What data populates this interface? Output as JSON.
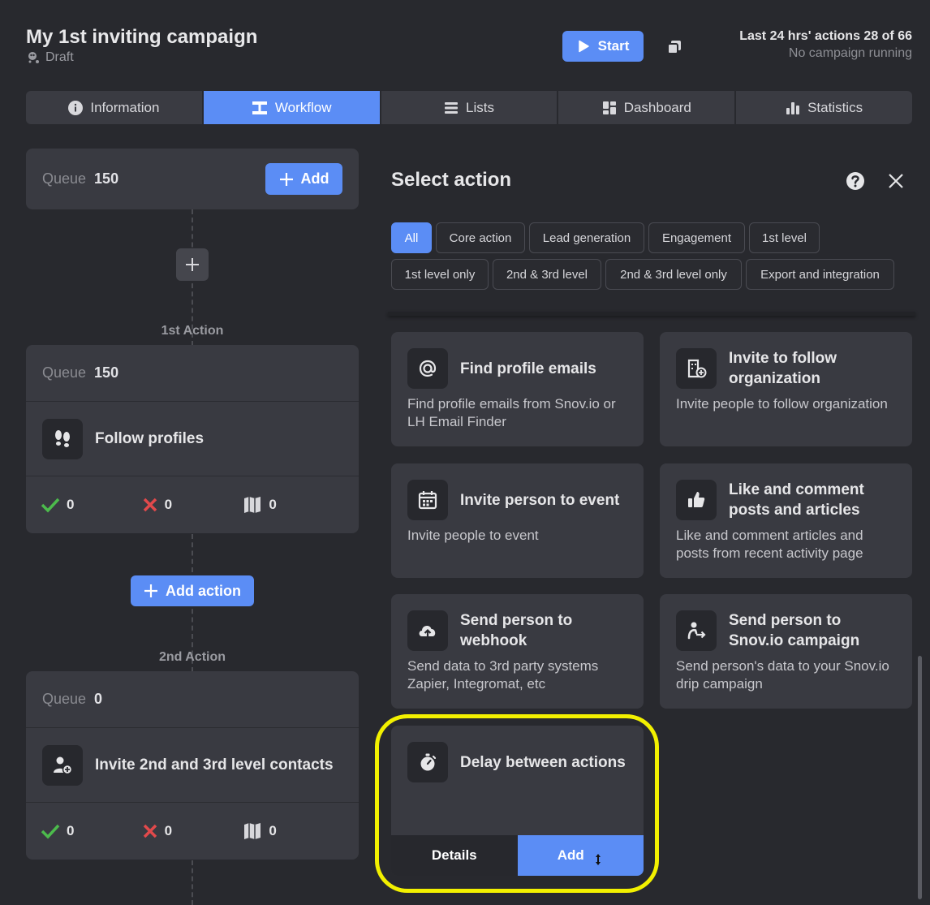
{
  "header": {
    "title": "My 1st inviting campaign",
    "status": "Draft",
    "start_label": "Start",
    "actions_text": "Last 24 hrs' actions 28 of 66",
    "running_text": "No campaign running"
  },
  "tabs": [
    {
      "label": "Information",
      "icon": "info-icon"
    },
    {
      "label": "Workflow",
      "icon": "workflow-icon",
      "active": true
    },
    {
      "label": "Lists",
      "icon": "list-icon"
    },
    {
      "label": "Dashboard",
      "icon": "dashboard-icon"
    },
    {
      "label": "Statistics",
      "icon": "bar-chart-icon"
    }
  ],
  "workflow": {
    "queue_label": "Queue",
    "top_queue": "150",
    "add_label": "Add",
    "add_action_label": "Add action",
    "steps": [
      {
        "label": "1st Action",
        "queue": "150",
        "name": "Follow profiles",
        "success": "0",
        "failed": "0",
        "excluded": "0"
      },
      {
        "label": "2nd Action",
        "queue": "0",
        "name": "Invite 2nd and 3rd level contacts",
        "success": "0",
        "failed": "0",
        "excluded": "0"
      }
    ]
  },
  "panel": {
    "title": "Select action",
    "filters": [
      "All",
      "Core action",
      "Lead generation",
      "Engagement",
      "1st level",
      "1st level only",
      "2nd & 3rd level",
      "2nd & 3rd level only",
      "Export and integration"
    ],
    "actions": [
      {
        "name": "Find profile emails",
        "desc": "Find profile emails from Snov.io or LH Email Finder",
        "icon": "at-sign-icon"
      },
      {
        "name": "Invite to follow organization",
        "desc": "Invite people to follow organization",
        "icon": "organization-add-icon"
      },
      {
        "name": "Invite person to event",
        "desc": "Invite people to event",
        "icon": "calendar-icon"
      },
      {
        "name": "Like and comment posts and articles",
        "desc": "Like and comment articles and posts from recent activity page",
        "icon": "thumbs-up-icon"
      },
      {
        "name": "Send person to webhook",
        "desc": "Send data to 3rd party systems Zapier, Integromat, etc",
        "icon": "cloud-upload-icon"
      },
      {
        "name": "Send person to Snov.io campaign",
        "desc": "Send person's data to your Snov.io drip campaign",
        "icon": "person-send-icon"
      }
    ],
    "delay": {
      "name": "Delay between actions",
      "icon": "stopwatch-icon",
      "details_label": "Details",
      "add_label": "Add"
    }
  },
  "colors": {
    "accent": "#5b8df5",
    "success": "#4cbb4c",
    "danger": "#e2494b",
    "highlight": "#f2f000"
  }
}
